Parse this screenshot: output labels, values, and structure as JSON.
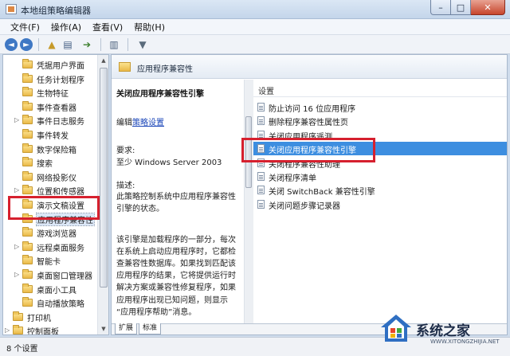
{
  "window": {
    "title": "本地组策略编辑器",
    "minimize": "–",
    "maximize": "□",
    "close": "✕"
  },
  "menu": [
    "文件(F)",
    "操作(A)",
    "查看(V)",
    "帮助(H)"
  ],
  "toolbar": {
    "back": "◄",
    "forward": "►",
    "up": "▲",
    "tree": "▤",
    "export": "➔",
    "properties": "▥",
    "filter": "▼"
  },
  "tree": [
    {
      "label": "凭据用户界面",
      "expandable": false
    },
    {
      "label": "任务计划程序",
      "expandable": false
    },
    {
      "label": "生物特征",
      "expandable": false
    },
    {
      "label": "事件查看器",
      "expandable": false
    },
    {
      "label": "事件日志服务",
      "expandable": true
    },
    {
      "label": "事件转发",
      "expandable": false
    },
    {
      "label": "数字保险箱",
      "expandable": false
    },
    {
      "label": "搜索",
      "expandable": false
    },
    {
      "label": "网络投影仪",
      "expandable": false
    },
    {
      "label": "位置和传感器",
      "expandable": true
    },
    {
      "label": "演示文稿设置",
      "expandable": false
    },
    {
      "label": "应用程序兼容性",
      "expandable": false,
      "selected": true
    },
    {
      "label": "游戏浏览器",
      "expandable": false
    },
    {
      "label": "远程桌面服务",
      "expandable": true
    },
    {
      "label": "智能卡",
      "expandable": false
    },
    {
      "label": "桌面窗口管理器",
      "expandable": true
    },
    {
      "label": "桌面小工具",
      "expandable": false
    },
    {
      "label": "自动播放策略",
      "expandable": false
    },
    {
      "label": "打印机",
      "expandable": false,
      "level": 0
    },
    {
      "label": "控制面板",
      "expandable": true,
      "level": 0
    }
  ],
  "tree_scroll": {
    "up": "▲",
    "down": "▼"
  },
  "content": {
    "header_title": "应用程序兼容性",
    "description": {
      "title": "关闭应用程序兼容性引擎",
      "edit_prefix": "编辑",
      "edit_link": "策略设置",
      "requirement_label": "要求:",
      "requirement_value": "至少 Windows Server 2003",
      "desc_label": "描述:",
      "lines": [
        " 此策略控制系统中应用程序兼容性",
        "引擎的状态。",
        "",
        "该引擎是加载程序的一部分，每次",
        "在系统上启动应用程序时，它都检",
        "查兼容性数据库。如果找到匹配该",
        "应用程序的结果，它将提供运行时",
        "解决方案或兼容性修复程序，如果",
        "应用程序出现已知问题，则显示",
        "“应用程序帮助”消息。"
      ]
    },
    "list_header": "设置",
    "settings": [
      "防止访问 16 位应用程序",
      "删除程序兼容性属性页",
      "关闭应用程序遥测",
      "关闭应用程序兼容性引擎",
      "关闭程序兼容性助理",
      "关闭程序清单",
      "关闭 SwitchBack 兼容性引擎",
      "关闭问题步骤记录器"
    ],
    "selected_setting_index": 3,
    "tabs": [
      "扩展",
      "标准"
    ]
  },
  "status": {
    "text": "8 个设置"
  },
  "watermark": {
    "brand": "系统之家",
    "url": "WWW.XITONGZHIJIA.NET"
  },
  "colors": {
    "highlight": "#d6202e",
    "selection": "#3d8ee0",
    "link": "#1a45b8"
  }
}
